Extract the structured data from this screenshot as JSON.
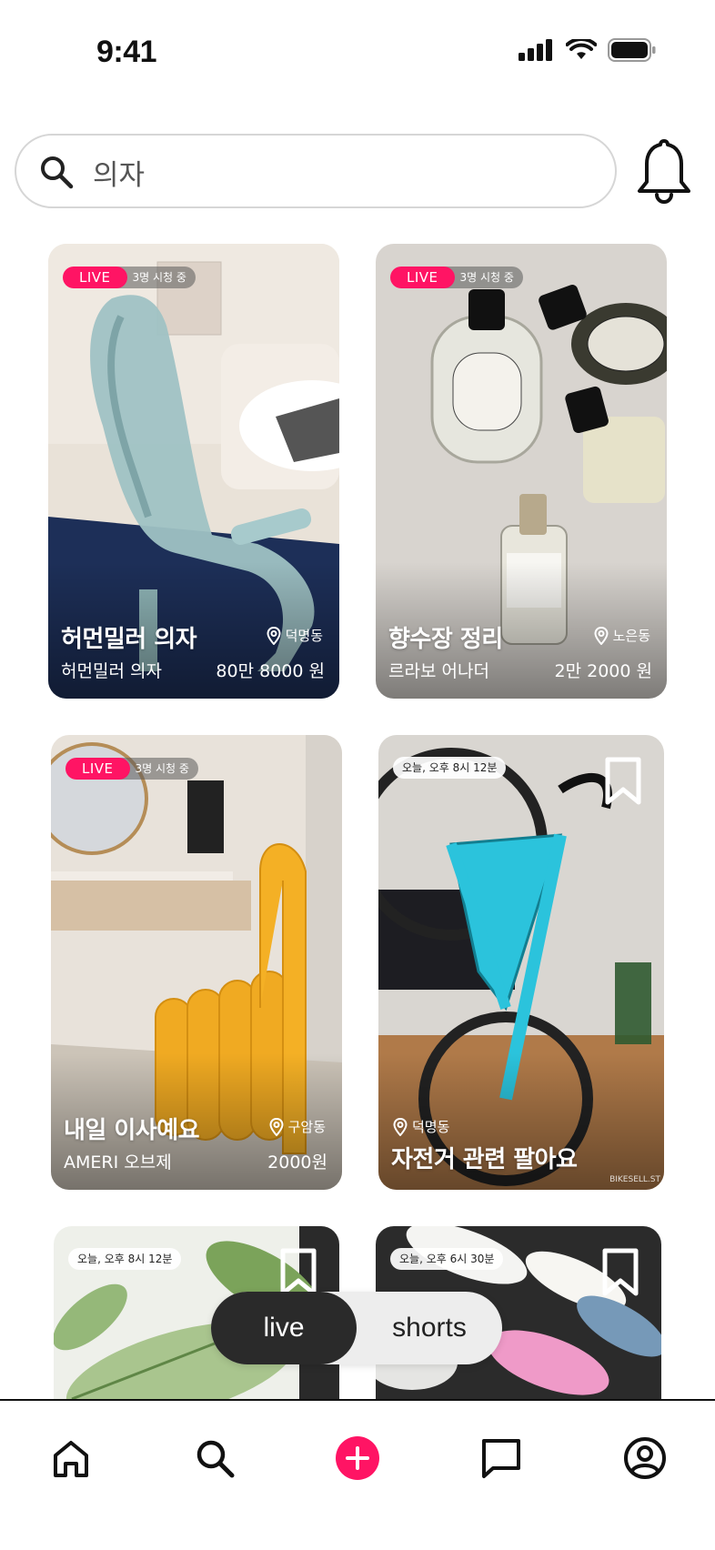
{
  "status_bar": {
    "time": "9:41"
  },
  "search": {
    "value": "의자",
    "placeholder": "의자"
  },
  "cards": [
    {
      "badge": "LIVE",
      "viewers": "3명 시청 중",
      "title": "허먼밀러 의자",
      "location": "덕명동",
      "seller": "허먼밀러 의자",
      "price": "80만 8000 원"
    },
    {
      "badge": "LIVE",
      "viewers": "3명 시청 중",
      "title": "향수장 정리",
      "location": "노은동",
      "seller": "르라보 어나더",
      "price": "2만 2000 원"
    },
    {
      "badge": "LIVE",
      "viewers": "3명 시청 중",
      "title": "내일 이사예요",
      "location": "구암동",
      "seller": "AMERI 오브제",
      "price": "2000원"
    },
    {
      "time": "오늘, 오후 8시 12분",
      "title": "자전거 관련 팔아요",
      "location": "덕명동",
      "watermark": "BIKESELL.ST"
    },
    {
      "time": "오늘, 오후 8시 12분"
    },
    {
      "time": "오늘, 오후 6시 30분"
    }
  ],
  "toggle": {
    "live": "live",
    "shorts": "shorts"
  },
  "colors": {
    "accent": "#ff1464",
    "toggle_active": "#2a2a2a"
  },
  "tabs": [
    "home-icon",
    "search-icon",
    "add-icon",
    "chat-icon",
    "profile-icon"
  ]
}
